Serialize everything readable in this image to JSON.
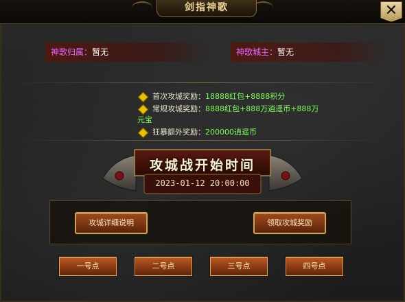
{
  "window": {
    "title": "剑指神歌",
    "close_symbol": "✕"
  },
  "owners": {
    "guild_label": "神歌归属：",
    "guild_value": "暂无",
    "lord_label": "神歌城主：",
    "lord_value": "暂无"
  },
  "rewards": [
    {
      "label": "首次攻城奖励：",
      "value": "18888红包+8888积分"
    },
    {
      "label": "常规攻城奖励：",
      "value": "8888红包+888万逍遥币+888万",
      "value_cont": "元宝"
    },
    {
      "label": "狂暴额外奖励：",
      "value": "200000逍遥币"
    }
  ],
  "banner": {
    "title": "攻城战开始时间",
    "time": "2023-01-12 20:00:00"
  },
  "actions": {
    "details_label": "攻城详细说明",
    "claim_label": "领取攻城奖励"
  },
  "points": [
    "一号点",
    "二号点",
    "三号点",
    "四号点"
  ],
  "colors": {
    "owner_label": "#e866ff",
    "reward_value": "#7cff5a",
    "accent_gold": "#c9a65a"
  }
}
